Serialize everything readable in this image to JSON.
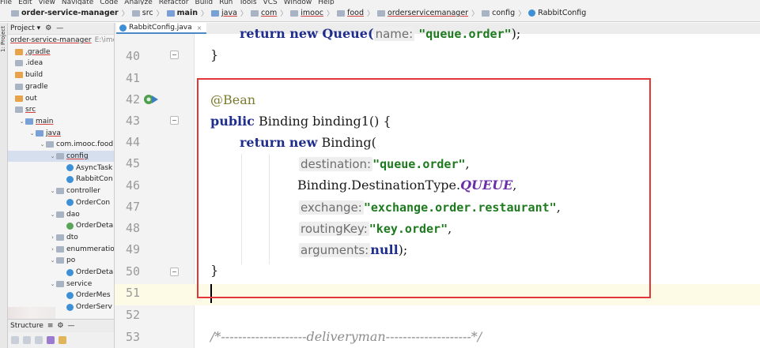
{
  "menubar": [
    "File",
    "Edit",
    "View",
    "Navigate",
    "Code",
    "Analyze",
    "Refactor",
    "Build",
    "Run",
    "Tools",
    "VCS",
    "Window",
    "Help"
  ],
  "breadcrumb": [
    "order-service-manager",
    "src",
    "main",
    "java",
    "com",
    "imooc",
    "food",
    "orderservicemanager",
    "config",
    "RabbitConfig"
  ],
  "left_strip": "1: Project",
  "project_panel": {
    "header_label": "Project",
    "tree": [
      {
        "label": "order-service-manager",
        "extra": "E:\\imo",
        "indent": 0
      },
      {
        "label": ".gradle",
        "indent": 0
      },
      {
        "label": ".idea",
        "indent": 0
      },
      {
        "label": "build",
        "indent": 0
      },
      {
        "label": "gradle",
        "indent": 0
      },
      {
        "label": "out",
        "indent": 0
      },
      {
        "label": "src",
        "indent": 0
      },
      {
        "label": "main",
        "indent": 1
      },
      {
        "label": "java",
        "indent": 2
      },
      {
        "label": "com.imooc.food.",
        "indent": 3
      },
      {
        "label": "config",
        "indent": 4
      },
      {
        "label": "AsyncTask",
        "indent": 5
      },
      {
        "label": "RabbitCon",
        "indent": 5
      },
      {
        "label": "controller",
        "indent": 4
      },
      {
        "label": "OrderCon",
        "indent": 5
      },
      {
        "label": "dao",
        "indent": 4
      },
      {
        "label": "OrderDeta",
        "indent": 5
      },
      {
        "label": "dto",
        "indent": 4
      },
      {
        "label": "enummeratio",
        "indent": 4
      },
      {
        "label": "po",
        "indent": 4
      },
      {
        "label": "OrderDeta",
        "indent": 5
      },
      {
        "label": "service",
        "indent": 4
      },
      {
        "label": "OrderMes",
        "indent": 5
      },
      {
        "label": "OrderServ",
        "indent": 5
      }
    ],
    "structure_label": "Structure"
  },
  "editor": {
    "tab_label": "RabbitConfig.java",
    "partial_top": {
      "code_a": "return new Queue(",
      "hint": "name:",
      "str": "\"queue.order\"",
      "code_b": ");"
    },
    "line_numbers": [
      "40",
      "41",
      "42",
      "43",
      "44",
      "45",
      "46",
      "47",
      "48",
      "49",
      "50",
      "51",
      "52",
      "53"
    ],
    "lines": {
      "l40": "}",
      "l42": "@Bean",
      "l43_kw": "public",
      "l43_rest": " Binding binding1() {",
      "l44_kw1": "return",
      "l44_mid": " ",
      "l44_kw2": "new",
      "l44_rest": " Binding(",
      "l45_hint": "destination:",
      "l45_str": "\"queue.order\"",
      "l45_end": ",",
      "l46_a": "Binding.DestinationType.",
      "l46_enum": "QUEUE",
      "l46_end": ",",
      "l47_hint": "exchange:",
      "l47_str": "\"exchange.order.restaurant\"",
      "l47_end": ",",
      "l48_hint": "routingKey:",
      "l48_str": "\"key.order\"",
      "l48_end": ",",
      "l49_hint": "arguments:",
      "l49_kw": "null",
      "l49_end": ");",
      "l50": "}",
      "l53": "/*--------------------deliveryman--------------------*/"
    }
  },
  "colors": {
    "highlight_box": "#e2363b",
    "keyword": "#1f2d8c",
    "string": "#1e7a1e",
    "annotation": "#7a7a2e",
    "enum_constant": "#6a2ea8"
  }
}
